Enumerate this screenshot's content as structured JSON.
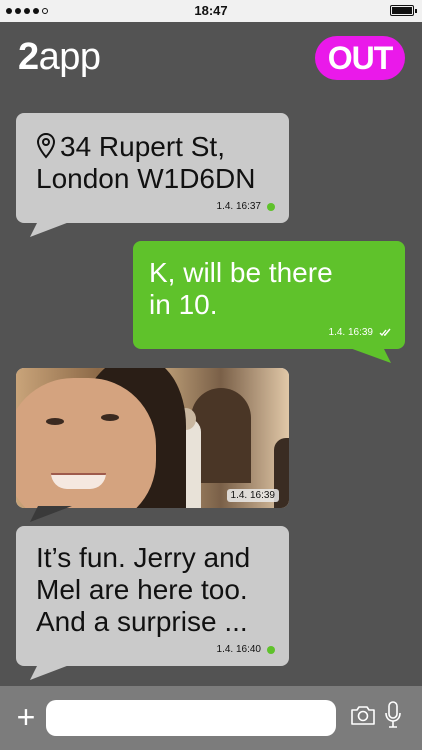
{
  "status_bar": {
    "time": "18:47"
  },
  "header": {
    "title_bold": "2",
    "title_rest": "app",
    "out_button_label": "OUT"
  },
  "messages": [
    {
      "direction": "in",
      "type": "location",
      "lines": [
        "34 Rupert St,",
        "London W1D6DN"
      ],
      "meta_time": "1.4. 16:37",
      "status": "green-dot"
    },
    {
      "direction": "out",
      "type": "text",
      "lines": [
        "K, will be there",
        "in 10."
      ],
      "meta_time": "1.4. 16:39",
      "status": "double-check"
    },
    {
      "direction": "in",
      "type": "photo",
      "meta_time": "1.4. 16:39"
    },
    {
      "direction": "in",
      "type": "text",
      "lines": [
        "It’s fun. Jerry and",
        "Mel are here too.",
        "And a surprise ..."
      ],
      "meta_time": "1.4. 16:40",
      "status": "green-dot"
    }
  ],
  "composer": {
    "value": "",
    "placeholder": ""
  },
  "icons": {
    "location": "location-pin-icon",
    "add": "plus-icon",
    "camera": "camera-icon",
    "mic": "microphone-icon",
    "read": "double-check-icon"
  },
  "colors": {
    "background": "#535353",
    "incoming_bubble": "#cacaca",
    "outgoing_bubble": "#5fc22b",
    "out_button": "#ea19ea",
    "status_green": "#5fc22b",
    "composer_bar": "#7c7c7c"
  }
}
